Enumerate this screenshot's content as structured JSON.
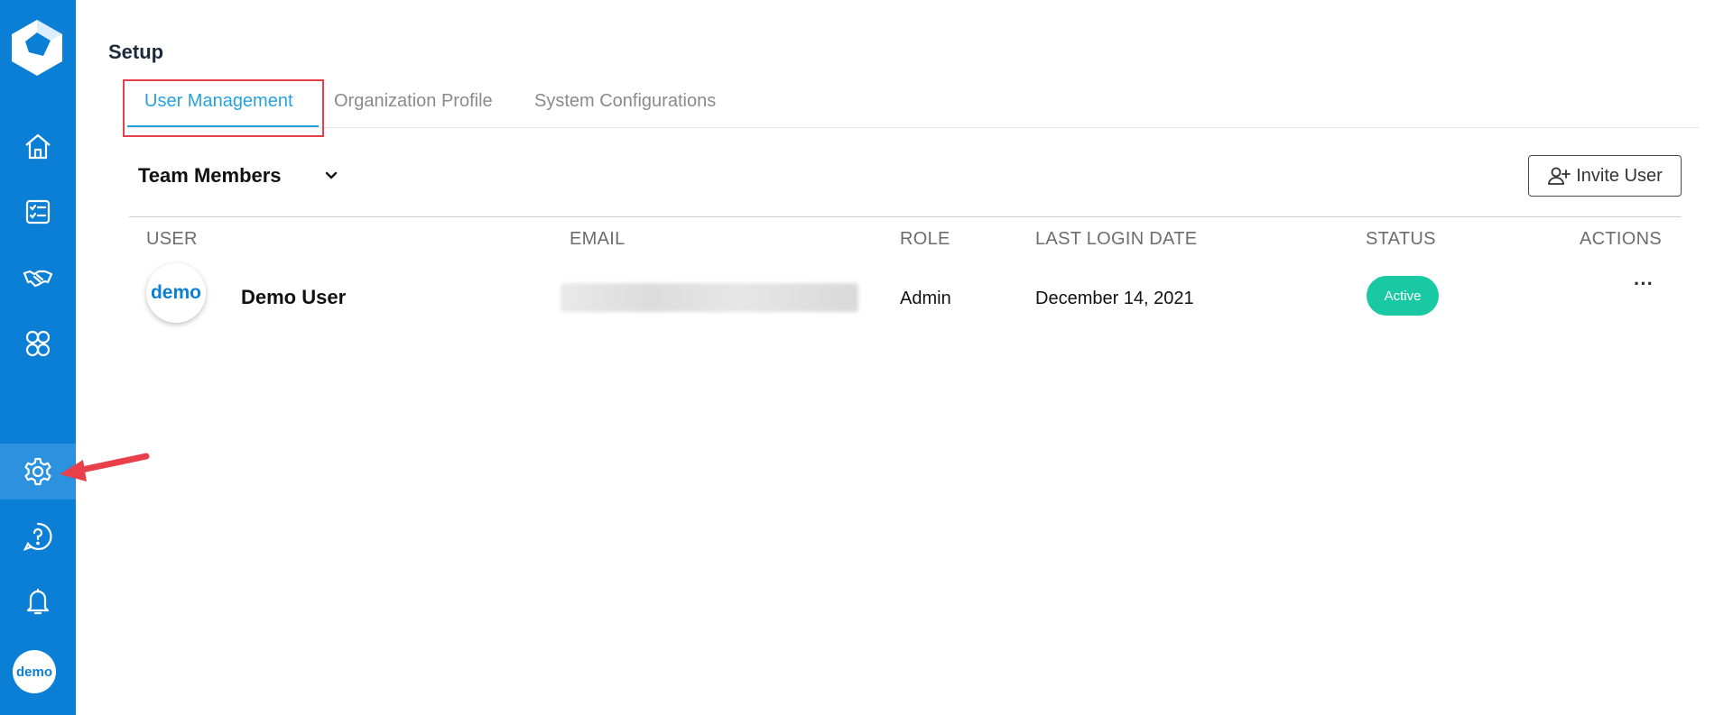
{
  "sidebar": {
    "logo_icon": "logo-cube-icon",
    "items": [
      {
        "name": "home",
        "icon": "home-icon"
      },
      {
        "name": "tasks",
        "icon": "checklist-icon"
      },
      {
        "name": "deals",
        "icon": "handshake-icon"
      },
      {
        "name": "groups",
        "icon": "people-icon"
      },
      {
        "name": "settings",
        "icon": "gear-icon",
        "active": true
      },
      {
        "name": "help",
        "icon": "help-icon"
      },
      {
        "name": "notifications",
        "icon": "bell-icon"
      }
    ],
    "avatar_text": "demo"
  },
  "page": {
    "title": "Setup"
  },
  "tabs": [
    {
      "label": "User Management",
      "active": true
    },
    {
      "label": "Organization Profile",
      "active": false
    },
    {
      "label": "System Configurations",
      "active": false
    }
  ],
  "team": {
    "label": "Team Members",
    "invite_label": "Invite User"
  },
  "table": {
    "columns": [
      "USER",
      "EMAIL",
      "ROLE",
      "LAST LOGIN DATE",
      "STATUS",
      "ACTIONS"
    ],
    "rows": [
      {
        "avatar_text": "demo",
        "name": "Demo User",
        "role": "Admin",
        "last_login": "December 14, 2021",
        "status": "Active",
        "actions": "···"
      }
    ]
  },
  "colors": {
    "sidebar": "#0b7fd6",
    "accent": "#27a2dd",
    "status_active": "#19c9a3",
    "highlight": "#e7404a"
  }
}
